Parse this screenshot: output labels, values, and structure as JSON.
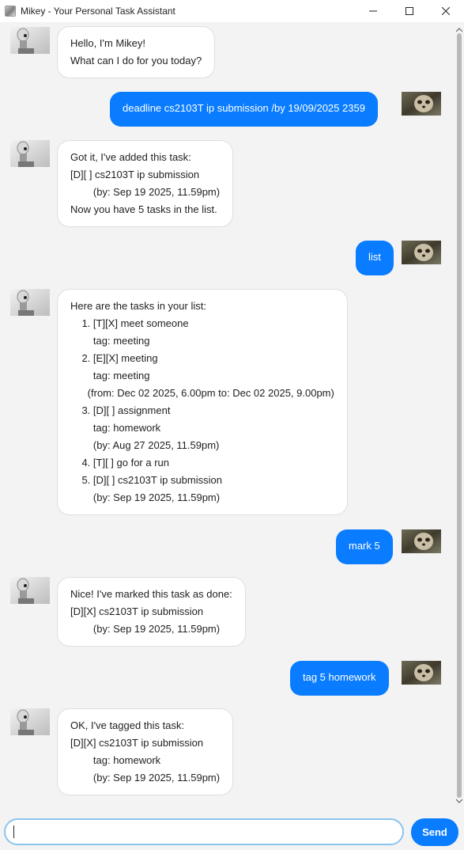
{
  "window": {
    "title": "Mikey - Your Personal Task Assistant",
    "app_icon": "app-icon",
    "controls": [
      "minimize-icon",
      "maximize-icon",
      "close-icon"
    ]
  },
  "chat": {
    "messages": [
      {
        "sender": "bot",
        "avatar": "robot-avatar",
        "lines": [
          "Hello, I'm Mikey!",
          "What can I do for you today?"
        ]
      },
      {
        "sender": "user",
        "avatar": "sloth-avatar",
        "lines": [
          "deadline cs2103T ip submission /by 19/09/2025 2359"
        ]
      },
      {
        "sender": "bot",
        "avatar": "robot-avatar",
        "lines": [
          "Got it, I've added this task:",
          "[D][ ] cs2103T ip submission",
          "        (by: Sep 19 2025, 11.59pm)",
          "Now you have 5 tasks in the list."
        ]
      },
      {
        "sender": "user",
        "avatar": "sloth-avatar",
        "lines": [
          "list"
        ]
      },
      {
        "sender": "bot",
        "avatar": "robot-avatar",
        "lines": [
          "Here are the tasks in your list:",
          "    1. [T][X] meet someone",
          "        tag: meeting",
          "    2. [E][X] meeting",
          "        tag: meeting",
          "      (from: Dec 02 2025, 6.00pm to: Dec 02 2025, 9.00pm)",
          "    3. [D][ ] assignment",
          "        tag: homework",
          "        (by: Aug 27 2025, 11.59pm)",
          "    4. [T][ ] go for a run",
          "    5. [D][ ] cs2103T ip submission",
          "        (by: Sep 19 2025, 11.59pm)"
        ]
      },
      {
        "sender": "user",
        "avatar": "sloth-avatar",
        "lines": [
          "mark 5"
        ]
      },
      {
        "sender": "bot",
        "avatar": "robot-avatar",
        "lines": [
          "Nice! I've marked this task as done:",
          "[D][X] cs2103T ip submission",
          "        (by: Sep 19 2025, 11.59pm)"
        ]
      },
      {
        "sender": "user",
        "avatar": "sloth-avatar",
        "lines": [
          "tag 5 homework"
        ]
      },
      {
        "sender": "bot",
        "avatar": "robot-avatar",
        "lines": [
          "OK, I've tagged this task:",
          "[D][X] cs2103T ip submission",
          "        tag: homework",
          "        (by: Sep 19 2025, 11.59pm)"
        ]
      }
    ]
  },
  "input": {
    "value": "",
    "placeholder": ""
  },
  "send_button": {
    "label": "Send"
  },
  "colors": {
    "user_bubble": "#0a7cff",
    "bot_bubble": "#ffffff",
    "background": "#f3f3f3",
    "input_focus": "#8cc4ee"
  }
}
